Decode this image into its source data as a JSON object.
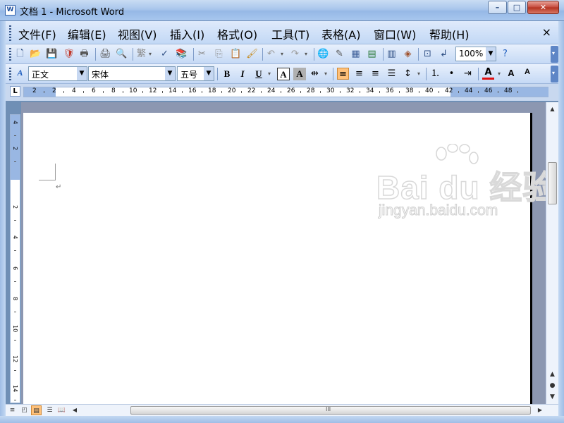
{
  "window": {
    "title": "文档 1 - Microsoft Word",
    "app_icon_glyph": "W"
  },
  "caption_buttons": {
    "minimize": "–",
    "maximize": "□",
    "close": "✕"
  },
  "menu": {
    "items": [
      "文件(F)",
      "编辑(E)",
      "视图(V)",
      "插入(I)",
      "格式(O)",
      "工具(T)",
      "表格(A)",
      "窗口(W)",
      "帮助(H)"
    ],
    "close_doc": "×"
  },
  "standard_toolbar": {
    "icons": [
      "new-document-icon",
      "open-folder-icon",
      "save-icon",
      "permission-icon",
      "print-icon-a",
      "print-icon",
      "print-preview-icon",
      "traditional-chinese-icon",
      "spelling-icon",
      "research-icon",
      "cut-icon",
      "copy-icon",
      "paste-icon",
      "format-painter-icon",
      "undo-icon",
      "redo-icon",
      "hyperlink-icon",
      "tables-borders-icon",
      "insert-table-icon",
      "insert-excel-icon",
      "columns-icon",
      "drawing-icon",
      "document-map-icon",
      "show-hide-icon",
      "help-icon"
    ],
    "traditional_glyph": "繁",
    "zoom": "100%"
  },
  "formatting_toolbar": {
    "style": "正文",
    "font": "宋体",
    "size": "五号",
    "bold": "B",
    "italic": "I",
    "underline": "U",
    "char_border": "A",
    "char_shading": "A",
    "grow_font": "A",
    "shrink_font": "A"
  },
  "ruler": {
    "tab_selector": "L",
    "h_numbers": [
      "2",
      "2",
      "4",
      "6",
      "8",
      "10",
      "12",
      "14",
      "16",
      "18",
      "20",
      "22",
      "24",
      "26",
      "28",
      "30",
      "32",
      "34",
      "36",
      "38",
      "40",
      "42",
      "44",
      "46",
      "48"
    ],
    "v_numbers": [
      "4",
      "2",
      "2",
      "4",
      "6",
      "8",
      "10",
      "12",
      "14"
    ]
  },
  "watermark": {
    "logo_text": "Bai du 经验",
    "url": "jingyan.baidu.com"
  },
  "document": {
    "paragraph_mark": "↵"
  },
  "scroll": {
    "h_thumb_grip": "III"
  },
  "colors": {
    "titlebar": "#a9c6ec",
    "toolbar": "#c5d9f5",
    "document_bg": "#8c97b1",
    "active_button": "#ffc17a",
    "font_color_bar": "#e01010"
  }
}
